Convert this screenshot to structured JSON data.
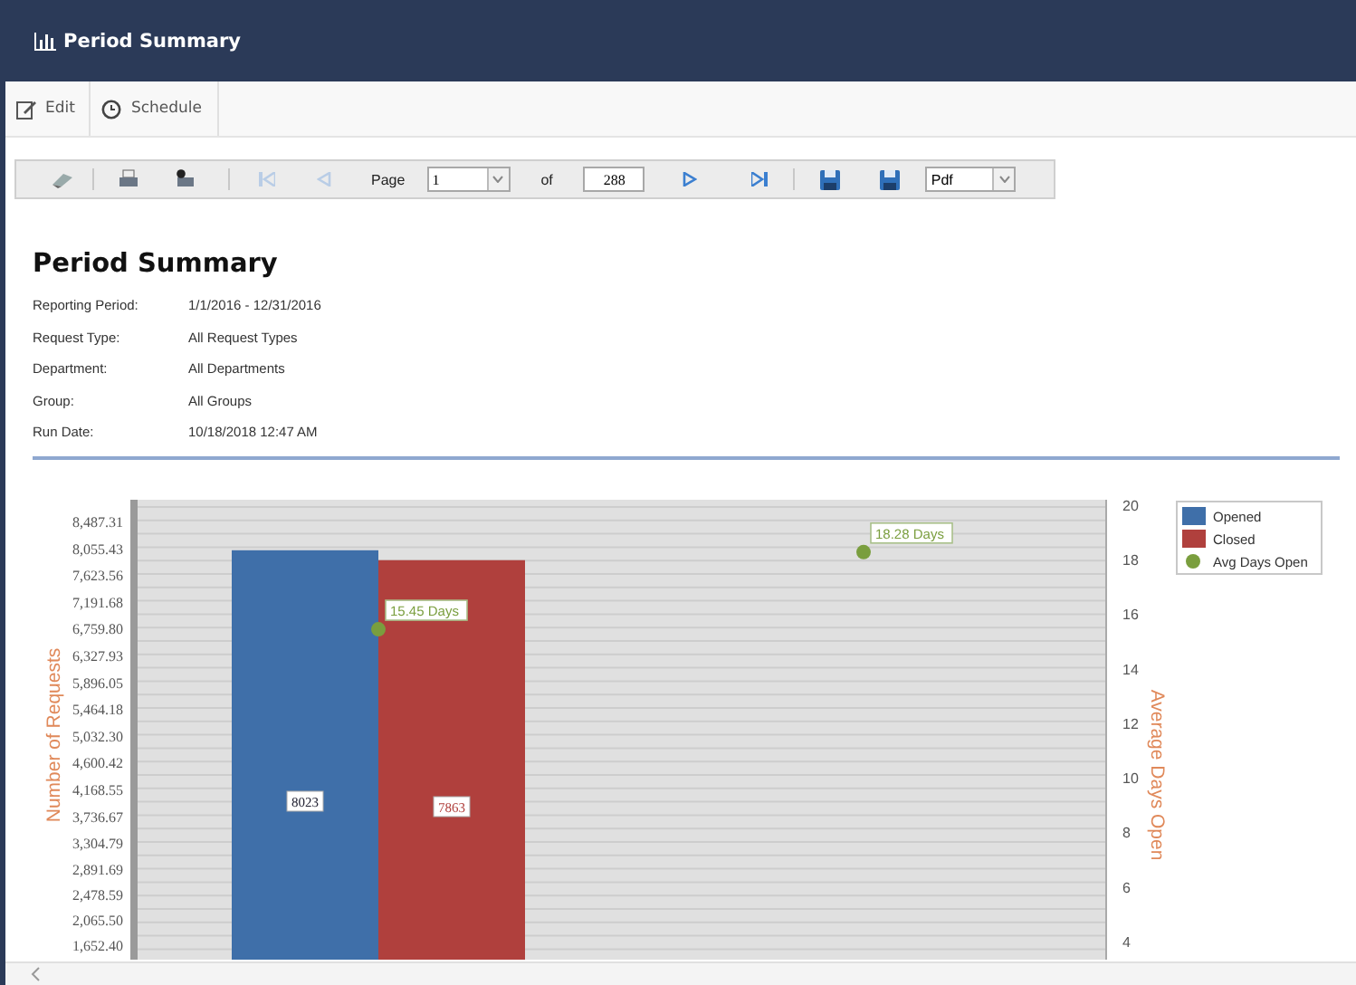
{
  "header": {
    "title": "Period Summary"
  },
  "actions": [
    {
      "kind": "edit",
      "label": "Edit"
    },
    {
      "kind": "schedule",
      "label": "Schedule"
    }
  ],
  "viewer_toolbar": {
    "first_page": {
      "disabled": true
    },
    "previous_page": {
      "disabled": true
    },
    "page_label": "Page",
    "page_value": "1",
    "of_label": "of",
    "page_total": "288",
    "next_page": {
      "disabled": false
    },
    "last_page": {
      "disabled": false
    },
    "export_format": "Pdf"
  },
  "report": {
    "title": "Period Summary",
    "details": [
      {
        "label": "Reporting Period:",
        "value": "1/1/2016 - 12/31/2016"
      },
      {
        "label": "Request Type:",
        "value": "All Request Types"
      },
      {
        "label": "Department:",
        "value": "All Departments"
      },
      {
        "label": "Group:",
        "value": "All Groups"
      },
      {
        "label": "Run Date:",
        "value": "10/18/2018 12:47 AM"
      }
    ],
    "chart_data": {
      "type": "bar",
      "stacked": false,
      "grid": true,
      "legend": true,
      "data_labels": true,
      "ylabel": "Number of Requests",
      "y2label": "Average Days Open",
      "ylim": [
        1426,
        8837
      ],
      "y2lim": [
        3.33,
        20.2
      ],
      "yticks": [
        {
          "value": 8487.31,
          "label": "8,487.31"
        },
        {
          "value": 8055.43,
          "label": "8,055.43"
        },
        {
          "value": 7623.56,
          "label": "7,623.56"
        },
        {
          "value": 7191.68,
          "label": "7,191.68"
        },
        {
          "value": 6759.8,
          "label": "6,759.80"
        },
        {
          "value": 6327.93,
          "label": "6,327.93"
        },
        {
          "value": 5896.05,
          "label": "5,896.05"
        },
        {
          "value": 5464.18,
          "label": "5,464.18"
        },
        {
          "value": 5032.3,
          "label": "5,032.30"
        },
        {
          "value": 4600.42,
          "label": "4,600.42"
        },
        {
          "value": 4168.55,
          "label": "4,168.55"
        },
        {
          "value": 3736.67,
          "label": "3,736.67"
        },
        {
          "value": 3304.79,
          "label": "3,304.79"
        },
        {
          "value": 2891.69,
          "label": "2,891.69"
        },
        {
          "value": 2478.59,
          "label": "2,478.59"
        },
        {
          "value": 2065.5,
          "label": "2,065.50"
        },
        {
          "value": 1652.4,
          "label": "1,652.40"
        }
      ],
      "y2ticks": [
        20,
        18,
        16,
        14,
        12,
        10,
        8,
        6,
        4
      ],
      "series": [
        {
          "name": "Opened",
          "color": "#3f6fa9",
          "type": "bar",
          "values": [
            8023,
            null
          ],
          "value_labels": [
            "8023",
            null
          ]
        },
        {
          "name": "Closed",
          "color": "#b0403d",
          "type": "bar",
          "values": [
            7863,
            null
          ],
          "value_labels": [
            "7863",
            null
          ]
        },
        {
          "name": "Avg Days Open",
          "color": "#7a9e3e",
          "type": "scatter",
          "axis": "y2",
          "values": [
            15.45,
            18.28
          ],
          "value_labels": [
            "15.45 Days",
            "18.28 Days"
          ]
        }
      ]
    }
  }
}
